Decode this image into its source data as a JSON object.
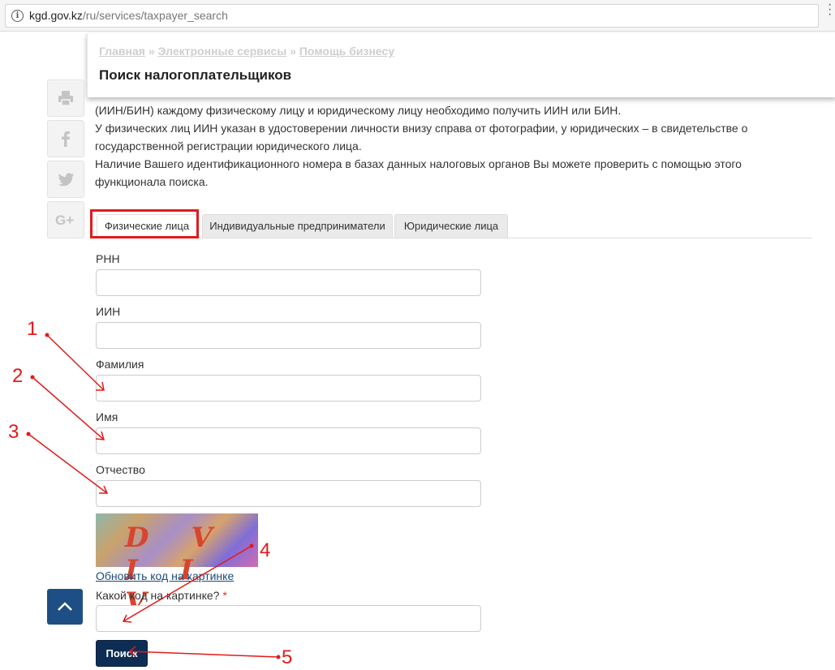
{
  "browser": {
    "url_host": "kgd.gov.kz",
    "url_path": "/ru/services/taxpayer_search"
  },
  "breadcrumb": {
    "items": [
      "Главная",
      "Электронные сервисы",
      "Помощь бизнесу"
    ],
    "separator": "»"
  },
  "page_title": "Поиск налогоплательщиков",
  "intro": [
    "(ИИН/БИН) каждому физическому лицу и юридическому лицу необходимо получить ИИН или БИН.",
    "У физических лиц ИИН указан в удостоверении личности внизу справа от фотографии, у юридических – в свидетельстве о",
    "государственной регистрации юридического лица.",
    "Наличие Вашего идентификационного номера в базах данных налоговых органов Вы можете проверить с помощью этого",
    "функционала поиска."
  ],
  "tabs": [
    {
      "label": "Физические лица",
      "active": true
    },
    {
      "label": "Индивидуальные предприниматели",
      "active": false
    },
    {
      "label": "Юридические лица",
      "active": false
    }
  ],
  "form": {
    "fields": [
      {
        "label": "РНН",
        "value": ""
      },
      {
        "label": "ИИН",
        "value": ""
      },
      {
        "label": "Фамилия",
        "value": ""
      },
      {
        "label": "Имя",
        "value": ""
      },
      {
        "label": "Отчество",
        "value": ""
      }
    ],
    "captcha_text": "D V I I V",
    "refresh_link": "Обновить код на картинке",
    "captcha_label": "Какой код на картинке?",
    "required_mark": "*",
    "captcha_value": "",
    "submit_label": "Поиск"
  },
  "share_icons": [
    "print-icon",
    "facebook-icon",
    "twitter-icon",
    "google-plus-icon"
  ],
  "annotations": [
    "1",
    "2",
    "3",
    "4",
    "5"
  ],
  "colors": {
    "annotation": "#e31a1a",
    "submit_button": "#0e2d54",
    "scroll_top_button": "#1d4f84",
    "captcha_link": "#1a4a7a"
  }
}
